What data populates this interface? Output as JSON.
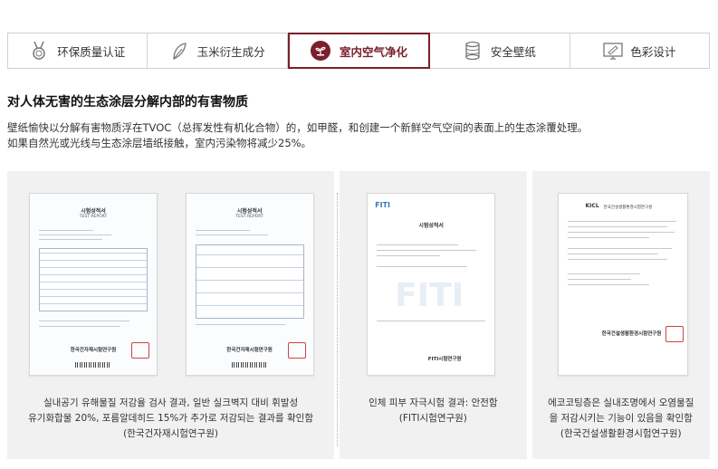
{
  "tabs": [
    {
      "label": "环保质量认证",
      "icon": "medal-icon",
      "active": false
    },
    {
      "label": "玉米衍生成分",
      "icon": "leaf-icon",
      "active": false
    },
    {
      "label": "室内空气净化",
      "icon": "eco-badge-icon",
      "active": true
    },
    {
      "label": "安全壁纸",
      "icon": "roll-icon",
      "active": false
    },
    {
      "label": "色彩设计",
      "icon": "palette-screen-icon",
      "active": false
    }
  ],
  "heading": "对人体无害的生态涂层分解内部的有害物质",
  "description": {
    "line1": "壁纸愉快以分解有害物质浮在TVOC（总挥发性有机化合物）的，如甲醛，和创建一个新鲜空气空间的表面上的生态涂覆处理。",
    "line2": "如果自然光或光线与生态涂层墙纸接触，室内污染物将减少25%。"
  },
  "certificates": {
    "doc1": {
      "title": "시험성적서",
      "subtitle": "TEST REPORT",
      "org": "한국건자재시험연구원"
    },
    "doc2": {
      "title": "시험성적서",
      "subtitle": "TEST REPORT",
      "org": "한국건자재시험연구원"
    },
    "doc3": {
      "logo": "FITI",
      "title": "시험성적서",
      "org": "FITI시험연구원"
    },
    "doc4": {
      "header": "KICL",
      "title": "한국건설생활환경시험연구원",
      "org": "한국건설생활환경시험연구원"
    }
  },
  "captions": {
    "c1": {
      "line1": "실내공기 유해물질 저감율 검사 결과, 일반 실크벽지 대비 휘발성",
      "line2": "유기화합물 20%, 포름알데히드 15%가 추가로 저감되는 결과를 확인함",
      "line3": "(한국건자재시험연구원)"
    },
    "c2": {
      "line1": "인체 피부 자극시험 결과: 안전함",
      "line2": "(FITI시험연구원)"
    },
    "c3": {
      "line1": "에코코팅층은 실내조명에서 오염물질",
      "line2": "을 저감시키는 기능이 있음을 확인함",
      "line3": "(한국건설생활환경시험연구원)"
    }
  },
  "colors": {
    "accent": "#7a1f2b",
    "panel_bg": "#f1f1f1",
    "border": "#cfcfcf"
  }
}
